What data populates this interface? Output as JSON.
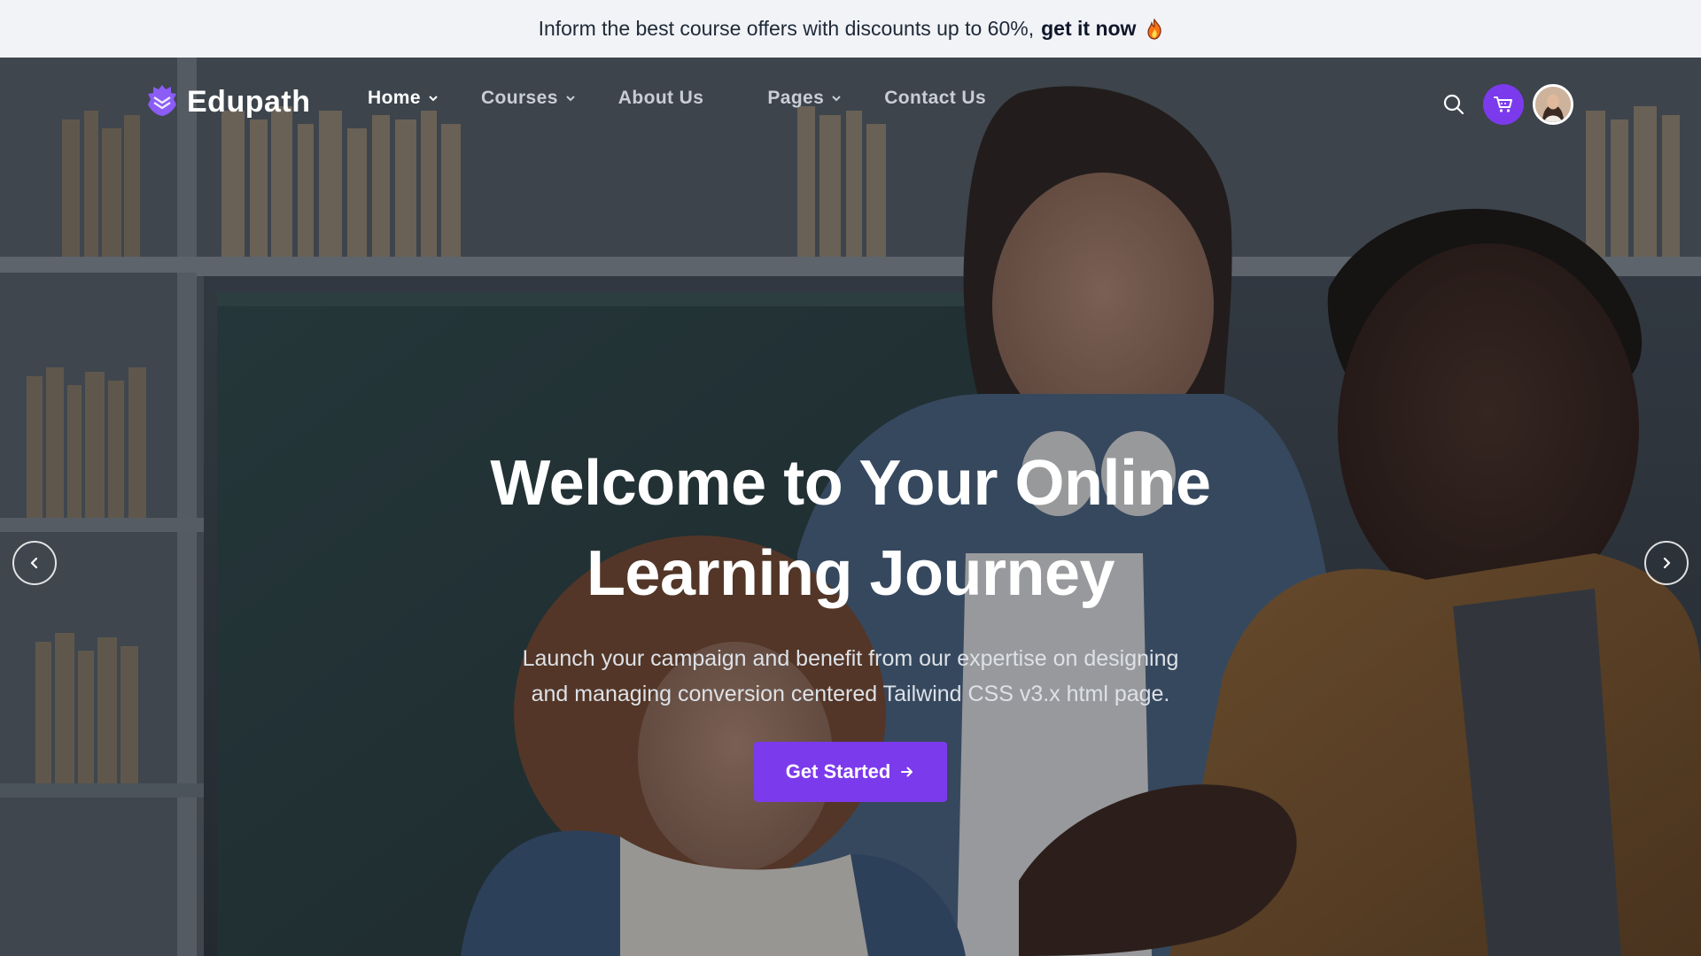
{
  "announcement": {
    "text": "Inform the best course offers with discounts up to 60%,",
    "cta": "get it now",
    "emoji_icon": "fire-icon"
  },
  "brand": {
    "name": "Edupath",
    "logo_icon": "edupath-shield-logo-icon",
    "accent_color": "#7c3aed"
  },
  "nav": {
    "items": [
      {
        "label": "Home",
        "has_dropdown": true,
        "active": true
      },
      {
        "label": "Courses",
        "has_dropdown": true,
        "active": false
      },
      {
        "label": "About Us",
        "has_dropdown": false,
        "active": false
      },
      {
        "label": "Pages",
        "has_dropdown": true,
        "active": false
      },
      {
        "label": "Contact Us",
        "has_dropdown": false,
        "active": false
      }
    ]
  },
  "header_actions": {
    "search_icon": "search-icon",
    "cart_icon": "cart-icon",
    "avatar": "user-avatar"
  },
  "hero": {
    "title_line1": "Welcome to Your Online",
    "title_line2": "Learning Journey",
    "subtitle_line1": "Launch your campaign and benefit from our expertise on designing",
    "subtitle_line2": "and managing conversion centered Tailwind CSS v3.x html page.",
    "cta_label": "Get Started",
    "cta_icon": "arrow-right-icon"
  },
  "slider": {
    "prev_icon": "chevron-left-icon",
    "next_icon": "chevron-right-icon"
  }
}
